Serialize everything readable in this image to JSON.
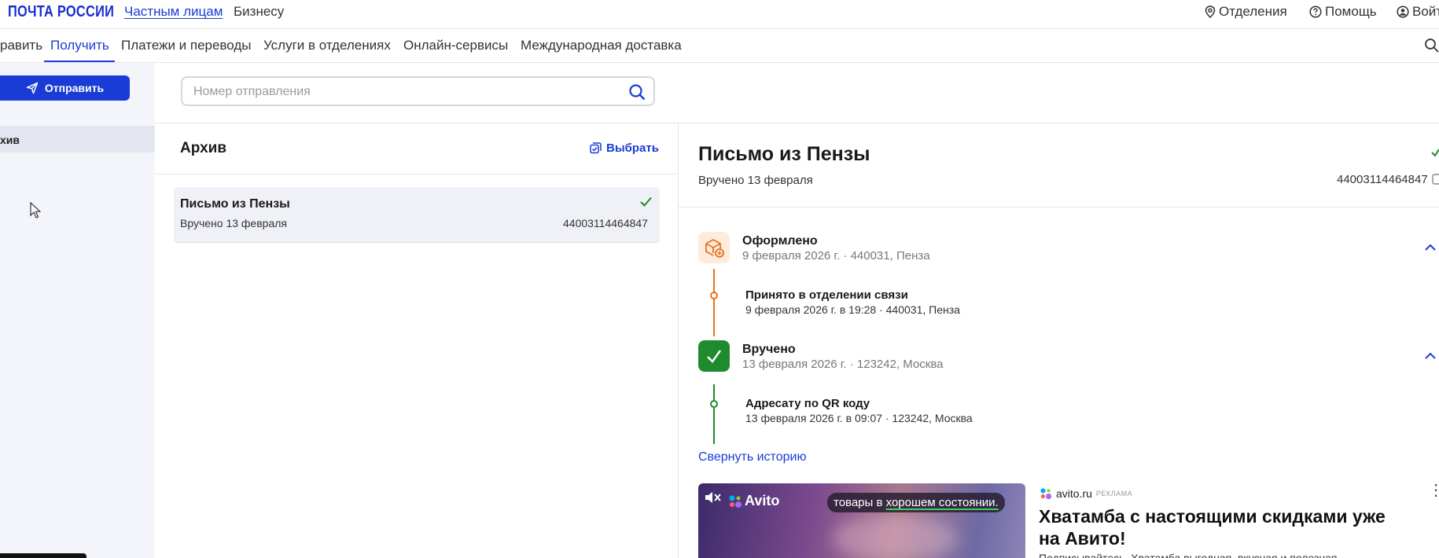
{
  "header": {
    "logo": "ПОЧТА РОССИИ",
    "segments": [
      "Частным лицам",
      "Бизнесу"
    ],
    "right_links": {
      "offices": "Отделения",
      "help": "Помощь",
      "login": "Войт"
    }
  },
  "nav": {
    "items": [
      "равить",
      "Получить",
      "Платежи и переводы",
      "Услуги в отделениях",
      "Онлайн-сервисы",
      "Международная доставка"
    ],
    "active": "Получить"
  },
  "sidebar": {
    "send_button": "Отправить",
    "selected_item": "хив"
  },
  "search": {
    "placeholder": "Номер отправления",
    "value": ""
  },
  "list": {
    "title": "Архив",
    "choose_label": "Выбрать",
    "items": [
      {
        "title": "Письмо из Пензы",
        "status": "Вручено 13 февраля",
        "number": "44003114464847"
      }
    ]
  },
  "detail": {
    "title": "Письмо из Пензы",
    "status": "Вручено 13 февраля",
    "number": "44003114464847",
    "stages": [
      {
        "title": "Оформлено",
        "meta": "9 февраля 2026 г. · 440031, Пенза",
        "color": "#e8711c",
        "icon": "package-add-icon",
        "events": [
          {
            "title": "Принято в отделении связи",
            "meta": "9 февраля 2026 г. в 19:28 · 440031, Пенза"
          }
        ]
      },
      {
        "title": "Вручено",
        "meta": "13 февраля 2026 г. · 123242, Москва",
        "color": "#1f8a2e",
        "icon": "check-icon",
        "events": [
          {
            "title": "Адресату по QR коду",
            "meta": "13 февраля 2026 г. в 09:07 · 123242, Москва"
          }
        ]
      }
    ],
    "collapse_label": "Свернуть историю"
  },
  "ad": {
    "logo_text": "Avito",
    "overlay_prefix": "товары в ",
    "overlay_highlight": "хорошем состоянии.",
    "source": "avito.ru",
    "source_tag": "РЕКЛАМА",
    "headline": "Хватамба с настоящими скидками уже на Авито!",
    "body": "Подписывайтесь. Хватамба выгодная, вкусная и полезная"
  },
  "colors": {
    "accent": "#1a3cd6",
    "success": "#1f8a2e",
    "warning": "#e8711c"
  }
}
